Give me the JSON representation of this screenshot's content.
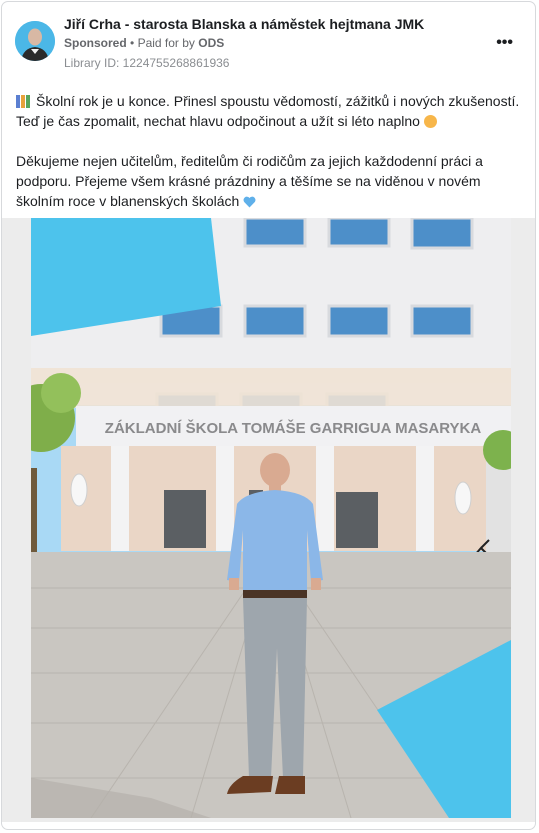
{
  "post": {
    "author": "Jiří Crha - starosta Blanska a náměstek hejtmana JMK",
    "sponsored_label": "Sponsored",
    "separator": "•",
    "paid_for_prefix": "Paid for by",
    "advertiser": "ODS",
    "library_id": "Library ID: 1224755268861936",
    "more_label": "•••",
    "paragraph_1": "Školní rok je u konce. Přinesl spoustu vědomostí, zážitků i nových zkušeností. Teď je čas zpomalit, nechat hlavu odpočinout a užít si léto naplno",
    "paragraph_2": "Děkujeme nejen učitelům, ředitelům či rodičům za jejich každodenní práci a podporu. Přejeme všem krásné prázdniny a těšíme se na viděnou v novém školním roce v blanenských školách",
    "icons": {
      "lead": "books-icon",
      "sun": "sun-emoji-icon",
      "heart": "blue-heart-icon",
      "more": "more-options-icon"
    },
    "colors": {
      "accent_blue": "#4dc3ec",
      "sky": "#a9d9f5",
      "facade": "#efeff1",
      "paving": "#c9c6c1"
    }
  },
  "image": {
    "school_sign": "ZÁKLADNÍ ŠKOLA TOMÁŠE GARRIGUA MASARYKA"
  }
}
